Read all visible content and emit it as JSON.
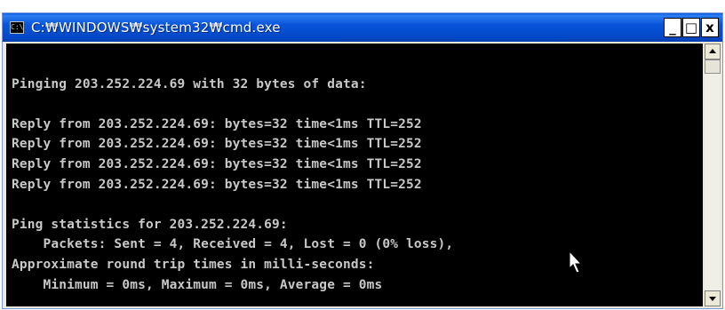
{
  "window": {
    "title": "C:₩WINDOWS₩system32₩cmd.exe",
    "app_icon_text": "C:\\",
    "buttons": {
      "minimize": "_",
      "maximize": "□",
      "close": "x"
    }
  },
  "console": {
    "lines": [
      "",
      "Pinging 203.252.224.69 with 32 bytes of data:",
      "",
      "Reply from 203.252.224.69: bytes=32 time<1ms TTL=252",
      "Reply from 203.252.224.69: bytes=32 time<1ms TTL=252",
      "Reply from 203.252.224.69: bytes=32 time<1ms TTL=252",
      "Reply from 203.252.224.69: bytes=32 time<1ms TTL=252",
      "",
      "Ping statistics for 203.252.224.69:",
      "    Packets: Sent = 4, Received = 4, Lost = 0 (0% loss),",
      "Approximate round trip times in milli-seconds:",
      "    Minimum = 0ms, Maximum = 0ms, Average = 0ms"
    ]
  },
  "colors": {
    "titlebar": "#0854d8",
    "console_bg": "#000000",
    "console_text": "#c8c8c8"
  },
  "icons": {
    "app": "cmd-icon",
    "scroll_up": "arrow-up-icon",
    "scroll_down": "arrow-down-icon",
    "cursor": "mouse-pointer-icon"
  }
}
